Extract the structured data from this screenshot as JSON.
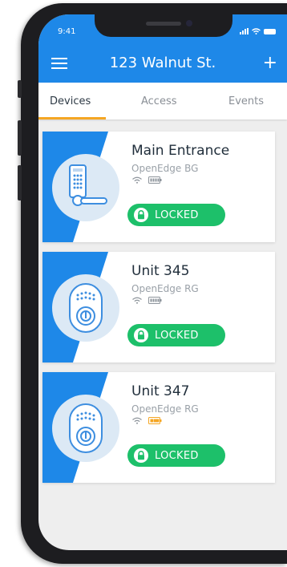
{
  "status_bar": {
    "time": "9:41"
  },
  "header": {
    "title": "123 Walnut St.",
    "menu_icon": "hamburger-menu-icon",
    "add_icon": "plus-icon",
    "plus_glyph": "+"
  },
  "tabs": [
    {
      "label": "Devices",
      "active": true
    },
    {
      "label": "Access",
      "active": false
    },
    {
      "label": "Events",
      "active": false
    }
  ],
  "devices": [
    {
      "name": "Main Entrance",
      "model": "OpenEdge BG",
      "lock_type": "lever-keypad-lock-icon",
      "battery": "full",
      "status": "LOCKED"
    },
    {
      "name": "Unit 345",
      "model": "OpenEdge RG",
      "lock_type": "deadbolt-keypad-lock-icon",
      "battery": "full",
      "status": "LOCKED"
    },
    {
      "name": "Unit 347",
      "model": "OpenEdge RG",
      "lock_type": "deadbolt-keypad-lock-icon",
      "battery": "low",
      "status": "LOCKED"
    }
  ],
  "colors": {
    "brand_blue": "#1e88e8",
    "active_tab_underline": "#f5a623",
    "locked_green": "#1dc06a",
    "battery_low": "#f5a623",
    "battery_ok": "#9aa1a8"
  }
}
